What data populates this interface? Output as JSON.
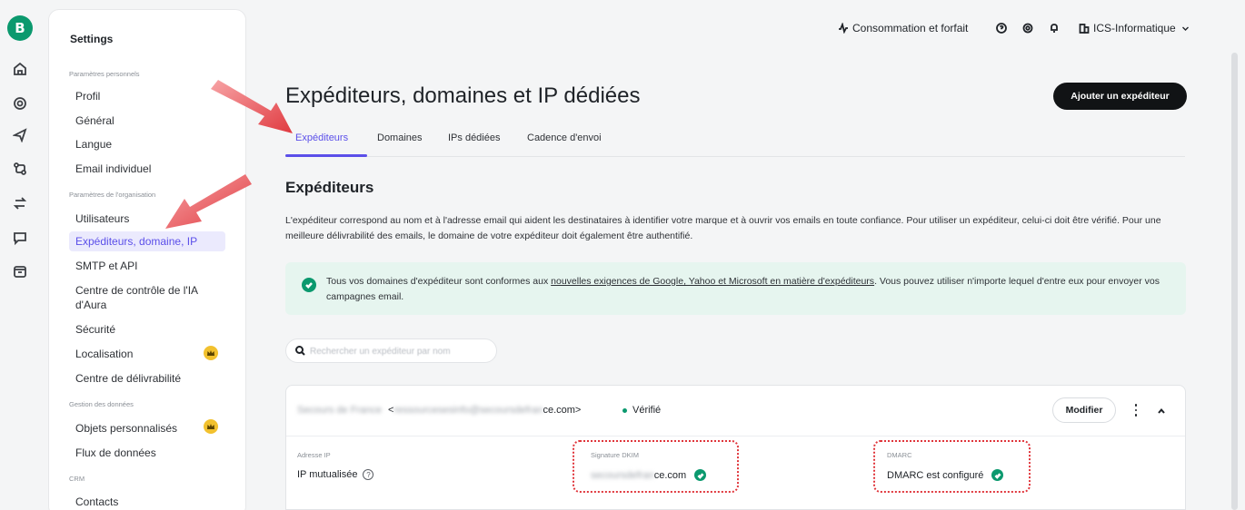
{
  "rail": {
    "logo": "B",
    "icons": [
      "home-icon",
      "contacts-icon",
      "campaign-send-icon",
      "automation-icon",
      "transactional-icon",
      "conversations-icon",
      "calendar-icon"
    ]
  },
  "sidebar": {
    "title": "Settings",
    "sections": [
      {
        "label": "Paramètres personnels"
      },
      {
        "label": "Paramètres de l'organisation"
      },
      {
        "label": "Gestion des données"
      },
      {
        "label": "CRM"
      }
    ],
    "items": [
      {
        "label": "Profil"
      },
      {
        "label": "Général"
      },
      {
        "label": "Langue"
      },
      {
        "label": "Email individuel"
      },
      {
        "label": "Utilisateurs"
      },
      {
        "label": "Expéditeurs, domaine, IP",
        "active": true
      },
      {
        "label": "SMTP et API"
      },
      {
        "label": "Centre de contrôle de l'IA d'Aura"
      },
      {
        "label": "Sécurité"
      },
      {
        "label": "Localisation",
        "badge": "crown-icon"
      },
      {
        "label": "Centre de délivrabilité"
      },
      {
        "label": "Objets personnalisés",
        "badge": "crown-icon"
      },
      {
        "label": "Flux de données"
      },
      {
        "label": "Contacts"
      }
    ]
  },
  "topbar": {
    "consumption": "Consommation et forfait",
    "account": "ICS-Informatique"
  },
  "main": {
    "title": "Expéditeurs, domaines et IP dédiées",
    "add_button": "Ajouter un expéditeur",
    "tabs": [
      {
        "label": "Expéditeurs",
        "active": true
      },
      {
        "label": "Domaines"
      },
      {
        "label": "IPs dédiées"
      },
      {
        "label": "Cadence d'envoi"
      }
    ],
    "section_title": "Expéditeurs",
    "description": "L'expéditeur correspond au nom et à l'adresse email qui aident les destinataires à identifier votre marque et à ouvrir vos emails en toute confiance. Pour utiliser un expéditeur, celui-ci doit être vérifié. Pour une meilleure délivrabilité des emails, le domaine de votre expéditeur doit également être authentifié.",
    "alert": {
      "before": "Tous vos domaines d'expéditeur sont conformes aux ",
      "link": "nouvelles exigences de Google, Yahoo et Microsoft en matière d'expéditeurs",
      "after": ". Vous pouvez utiliser n'importe lequel d'entre eux pour envoyer vos campagnes email."
    },
    "search_placeholder": "Rechercher un expéditeur par nom",
    "sender": {
      "name_blurred": "Secours de France",
      "email_prefix": "<",
      "email_blurred": "ressourcesesinfo@secoursdefran",
      "email_suffix": "ce.com>",
      "status": "Vérifié",
      "modify_button": "Modifier",
      "ip": {
        "label": "Adresse IP",
        "value": "IP mutualisée"
      },
      "dkim": {
        "label": "Signature DKIM",
        "value_blurred": "secoursdefran",
        "value_suffix": "ce.com"
      },
      "dmarc": {
        "label": "DMARC",
        "value": "DMARC est configuré"
      }
    }
  },
  "colors": {
    "accent": "#5b4fe9",
    "success": "#0b996e",
    "annotation": "#e0353b",
    "badge": "#f2c12e"
  }
}
